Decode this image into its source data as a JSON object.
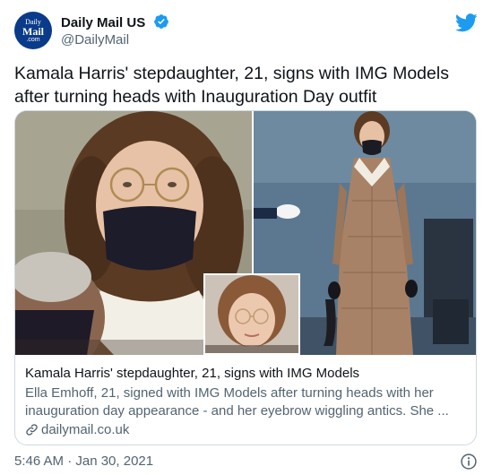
{
  "account": {
    "display_name": "Daily Mail US",
    "handle": "@DailyMail",
    "avatar_line1": "Daily",
    "avatar_line2": "Mail",
    "avatar_line3": ".com",
    "avatar_color": "#0a3a8a"
  },
  "tweet": {
    "text": "Kamala Harris' stepdaughter, 21, signs with IMG Models after turning heads with Inauguration Day outfit",
    "timestamp": "5:46 AM · Jan 30, 2021"
  },
  "card": {
    "title": "Kamala Harris' stepdaughter, 21, signs with IMG Models",
    "description": "Ella Emhoff, 21, signed with IMG Models after turning heads with her inauguration day appearance - and her eyebrow wiggling antics. She ...",
    "domain": "dailymail.co.uk"
  },
  "icons": {
    "verified": "verified-badge-icon",
    "bird": "twitter-bird-icon",
    "link": "link-icon",
    "info": "info-icon"
  },
  "colors": {
    "brand_blue": "#1d9bf0",
    "muted_text": "#536471",
    "border": "#cfd9de"
  }
}
